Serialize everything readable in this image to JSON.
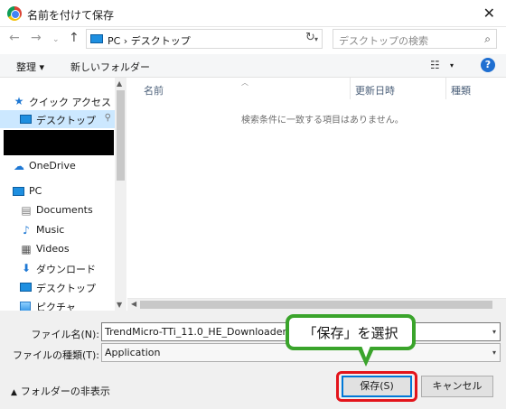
{
  "window": {
    "title": "名前を付けて保存",
    "close_glyph": "✕"
  },
  "address": {
    "path": "PC  ›  デスクトップ",
    "search_placeholder": "デスクトップの検索"
  },
  "nav_buttons": {
    "back": "←",
    "forward": "→",
    "recent": "⌄",
    "up": "↑",
    "refresh": "↻",
    "search_icon": "⌕"
  },
  "toolbar": {
    "organize": "整理 ▾",
    "new_folder": "新しいフォルダー",
    "view_glyph": "☷",
    "view_drop": "▾",
    "help": "?"
  },
  "nav": {
    "quick_access": "クイック アクセス",
    "desktop_pinned": "デスクトップ",
    "onedrive": "OneDrive",
    "pc": "PC",
    "documents": "Documents",
    "music": "Music",
    "videos": "Videos",
    "downloads": "ダウンロード",
    "desktop": "デスクトップ",
    "pictures": "ピクチャ",
    "pin_glyph": "⚲"
  },
  "columns": {
    "name": "名前",
    "date": "更新日時",
    "type": "種類"
  },
  "content": {
    "empty_message": "検索条件に一致する項目はありません。"
  },
  "form": {
    "filename_label": "ファイル名(N):",
    "filename_value": "TrendMicro-TTi_11.0_HE_Downloader",
    "filetype_label": "ファイルの種類(T):",
    "filetype_value": "Application"
  },
  "footer": {
    "hide_folders": "フォルダーの非表示",
    "save": "保存(S)",
    "cancel": "キャンセル"
  },
  "annotation": {
    "callout": "「保存」を選択"
  },
  "colors": {
    "callout_border": "#3aa42b",
    "highlight": "#e3141b",
    "selection": "#cce8ff",
    "accent": "#0078d7"
  }
}
